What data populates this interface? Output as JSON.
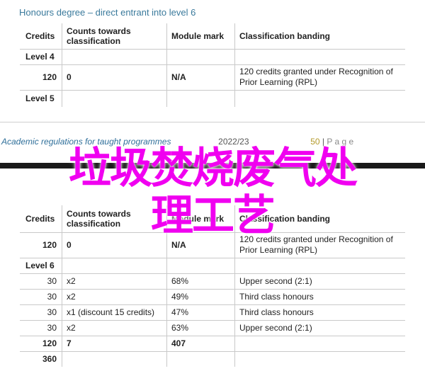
{
  "section_title": "Honours degree – direct entrant into level 6",
  "table1": {
    "headers": [
      "Credits",
      "Counts towards classification",
      "Module mark",
      "Classification banding"
    ],
    "level4_label": "Level 4",
    "row1": {
      "credits": "120",
      "counts": "0",
      "mark": "N/A",
      "banding": "120 credits granted under Recognition of Prior Learning (RPL)"
    },
    "level5_label": "Level 5"
  },
  "footer": {
    "left": "Academic regulations for taught programmes",
    "year": "2022/23",
    "page": "50",
    "sep": "|",
    "pg": "P a g e"
  },
  "table2": {
    "headers": [
      "Credits",
      "Counts towards classification",
      "Module mark",
      "Classification banding"
    ],
    "row1": {
      "credits": "120",
      "counts": "0",
      "mark": "N/A",
      "banding": "120 credits granted under Recognition of Prior Learning (RPL)"
    },
    "level6_label": "Level 6",
    "rows": [
      {
        "credits": "30",
        "counts": "x2",
        "mark": "68%",
        "banding": "Upper second (2:1)"
      },
      {
        "credits": "30",
        "counts": "x2",
        "mark": "49%",
        "banding": "Third class honours"
      },
      {
        "credits": "30",
        "counts": "x1 (discount 15 credits)",
        "mark": "47%",
        "banding": "Third class honours"
      },
      {
        "credits": "30",
        "counts": "x2",
        "mark": "63%",
        "banding": "Upper second (2:1)"
      }
    ],
    "total": {
      "credits": "120",
      "counts": "7",
      "mark": "407"
    },
    "grand_total": {
      "credits": "360"
    }
  },
  "overlay": {
    "line1": "垃圾焚烧废气处",
    "line2": "理工艺"
  },
  "colors": {
    "overlay": "#f000f0",
    "title": "#3a7a9c",
    "bar": "#1a1a1a"
  }
}
